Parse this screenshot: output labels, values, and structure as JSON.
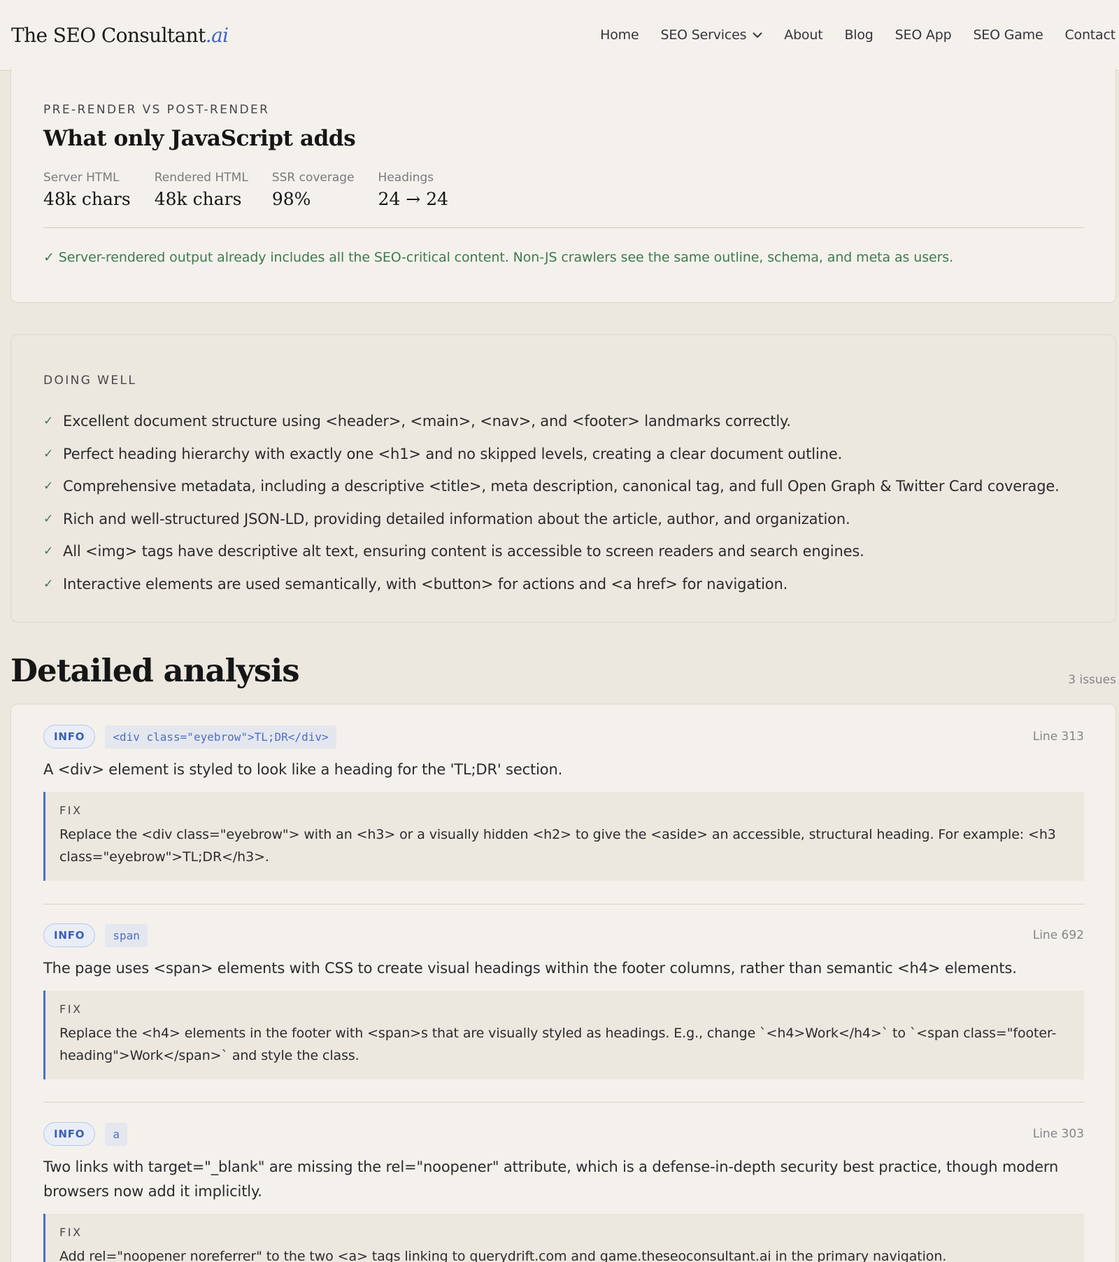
{
  "header": {
    "logo_main": "The SEO Consultant",
    "logo_suffix": ".ai",
    "nav": [
      {
        "label": "Home"
      },
      {
        "label": "SEO Services"
      },
      {
        "label": "About"
      },
      {
        "label": "Blog"
      },
      {
        "label": "SEO App"
      },
      {
        "label": "SEO Game"
      },
      {
        "label": "Contact"
      }
    ]
  },
  "render": {
    "eyebrow": "PRE-RENDER VS POST-RENDER",
    "title": "What only JavaScript adds",
    "stats": [
      {
        "label": "Server HTML",
        "value": "48k chars"
      },
      {
        "label": "Rendered HTML",
        "value": "48k chars"
      },
      {
        "label": "SSR coverage",
        "value": "98%"
      },
      {
        "label": "Headings",
        "value": "24 → 24"
      }
    ],
    "note": "✓ Server-rendered output already includes all the SEO-critical content. Non-JS crawlers see the same outline, schema, and meta as users."
  },
  "doing_well": {
    "eyebrow": "DOING WELL",
    "check": "✓",
    "items": [
      "Excellent document structure using <header>, <main>, <nav>, and <footer> landmarks correctly.",
      "Perfect heading hierarchy with exactly one <h1> and no skipped levels, creating a clear document outline.",
      "Comprehensive metadata, including a descriptive <title>, meta description, canonical tag, and full Open Graph & Twitter Card coverage.",
      "Rich and well-structured JSON-LD, providing detailed information about the article, author, and organization.",
      "All <img> tags have descriptive alt text, ensuring content is accessible to screen readers and search engines.",
      "Interactive elements are used semantically, with <button> for actions and <a href> for navigation."
    ]
  },
  "analysis": {
    "title": "Detailed analysis",
    "count": "3 issues",
    "fix_label": "FIX",
    "issues": [
      {
        "severity": "INFO",
        "element": "<div class=\"eyebrow\">TL;DR</div>",
        "line": "Line 313",
        "description": "A <div> element is styled to look like a heading for the 'TL;DR' section.",
        "fix": "Replace the <div class=\"eyebrow\"> with an <h3> or a visually hidden <h2> to give the <aside> an accessible, structural heading. For example: <h3 class=\"eyebrow\">TL;DR</h3>."
      },
      {
        "severity": "INFO",
        "element": "span",
        "line": "Line 692",
        "description": "The page uses <span> elements with CSS to create visual headings within the footer columns, rather than semantic <h4> elements.",
        "fix": "Replace the <h4> elements in the footer with <span>s that are visually styled as headings. E.g., change `<h4>Work</h4>` to `<span class=\"footer-heading\">Work</span>` and style the class."
      },
      {
        "severity": "INFO",
        "element": "a",
        "line": "Line 303",
        "description": "Two links with target=\"_blank\" are missing the rel=\"noopener\" attribute, which is a defense-in-depth security best practice, though modern browsers now add it implicitly.",
        "fix": "Add rel=\"noopener noreferrer\" to the two <a> tags linking to querydrift.com and game.theseoconsultant.ai in the primary navigation."
      }
    ]
  }
}
